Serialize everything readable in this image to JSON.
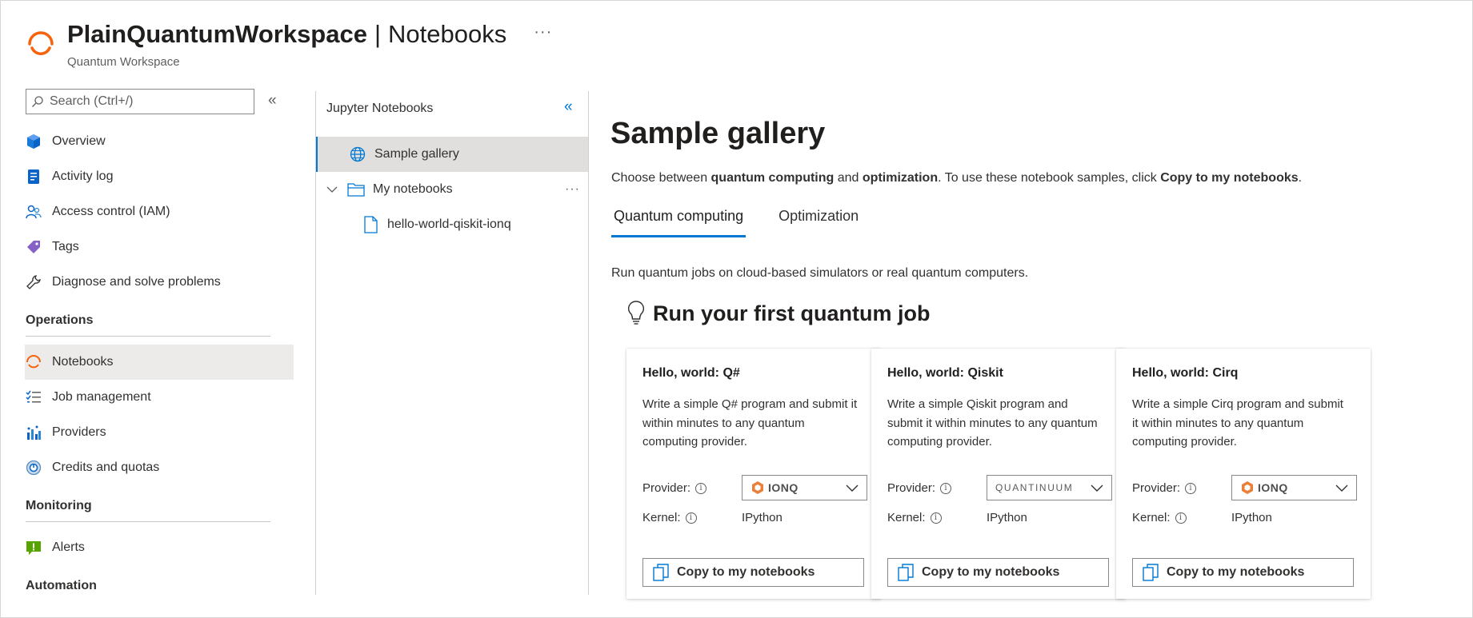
{
  "header": {
    "workspace": "PlainQuantumWorkspace",
    "separator": "|",
    "page": "Notebooks",
    "more": "···",
    "subtitle": "Quantum Workspace"
  },
  "leftnav": {
    "search_placeholder": "Search (Ctrl+/)",
    "collapse": "«",
    "items_top": [
      {
        "label": "Overview",
        "icon": "overview-icon"
      },
      {
        "label": "Activity log",
        "icon": "activity-log-icon"
      },
      {
        "label": "Access control (IAM)",
        "icon": "access-control-icon"
      },
      {
        "label": "Tags",
        "icon": "tag-icon"
      },
      {
        "label": "Diagnose and solve problems",
        "icon": "wrench-icon"
      }
    ],
    "section_operations": "Operations",
    "items_operations": [
      {
        "label": "Notebooks",
        "icon": "notebooks-icon",
        "selected": true
      },
      {
        "label": "Job management",
        "icon": "job-management-icon"
      },
      {
        "label": "Providers",
        "icon": "providers-icon"
      },
      {
        "label": "Credits and quotas",
        "icon": "credits-icon"
      }
    ],
    "section_monitoring": "Monitoring",
    "items_monitoring": [
      {
        "label": "Alerts",
        "icon": "alerts-icon"
      }
    ],
    "section_automation": "Automation"
  },
  "tree": {
    "title": "Jupyter Notebooks",
    "collapse": "«",
    "sample_gallery": "Sample gallery",
    "my_notebooks": "My notebooks",
    "my_notebooks_more": "···",
    "notebook_file": "hello-world-qiskit-ionq"
  },
  "main": {
    "title": "Sample gallery",
    "desc_1": "Choose between ",
    "desc_b1": "quantum computing",
    "desc_2": " and ",
    "desc_b2": "optimization",
    "desc_3": ". To use these notebook samples, click ",
    "desc_b3": "Copy to my notebooks",
    "desc_4": ".",
    "tabs": [
      "Quantum computing",
      "Optimization"
    ],
    "intro": "Run quantum jobs on cloud-based simulators or real quantum computers.",
    "section_title": "Run your first quantum job"
  },
  "cards": [
    {
      "title": "Hello, world: Q#",
      "desc": "Write a simple Q# program and submit it within minutes to any quantum computing provider.",
      "provider_label": "Provider:",
      "provider": "IONQ",
      "kernel_label": "Kernel:",
      "kernel": "IPython",
      "button": "Copy to my notebooks"
    },
    {
      "title": "Hello, world: Qiskit",
      "desc": "Write a simple Qiskit program and submit it within minutes to any quantum computing provider.",
      "provider_label": "Provider:",
      "provider": "QUANTINUUM",
      "kernel_label": "Kernel:",
      "kernel": "IPython",
      "button": "Copy to my notebooks"
    },
    {
      "title": "Hello, world: Cirq",
      "desc": "Write a simple Cirq program and submit it within minutes to any quantum computing provider.",
      "provider_label": "Provider:",
      "provider": "IONQ",
      "kernel_label": "Kernel:",
      "kernel": "IPython",
      "button": "Copy to my notebooks"
    }
  ],
  "colors": {
    "accent": "#0078d4",
    "brand_orange": "#f7630c",
    "ionq_orange": "#e8803a",
    "selected_bg": "#edebe9"
  }
}
